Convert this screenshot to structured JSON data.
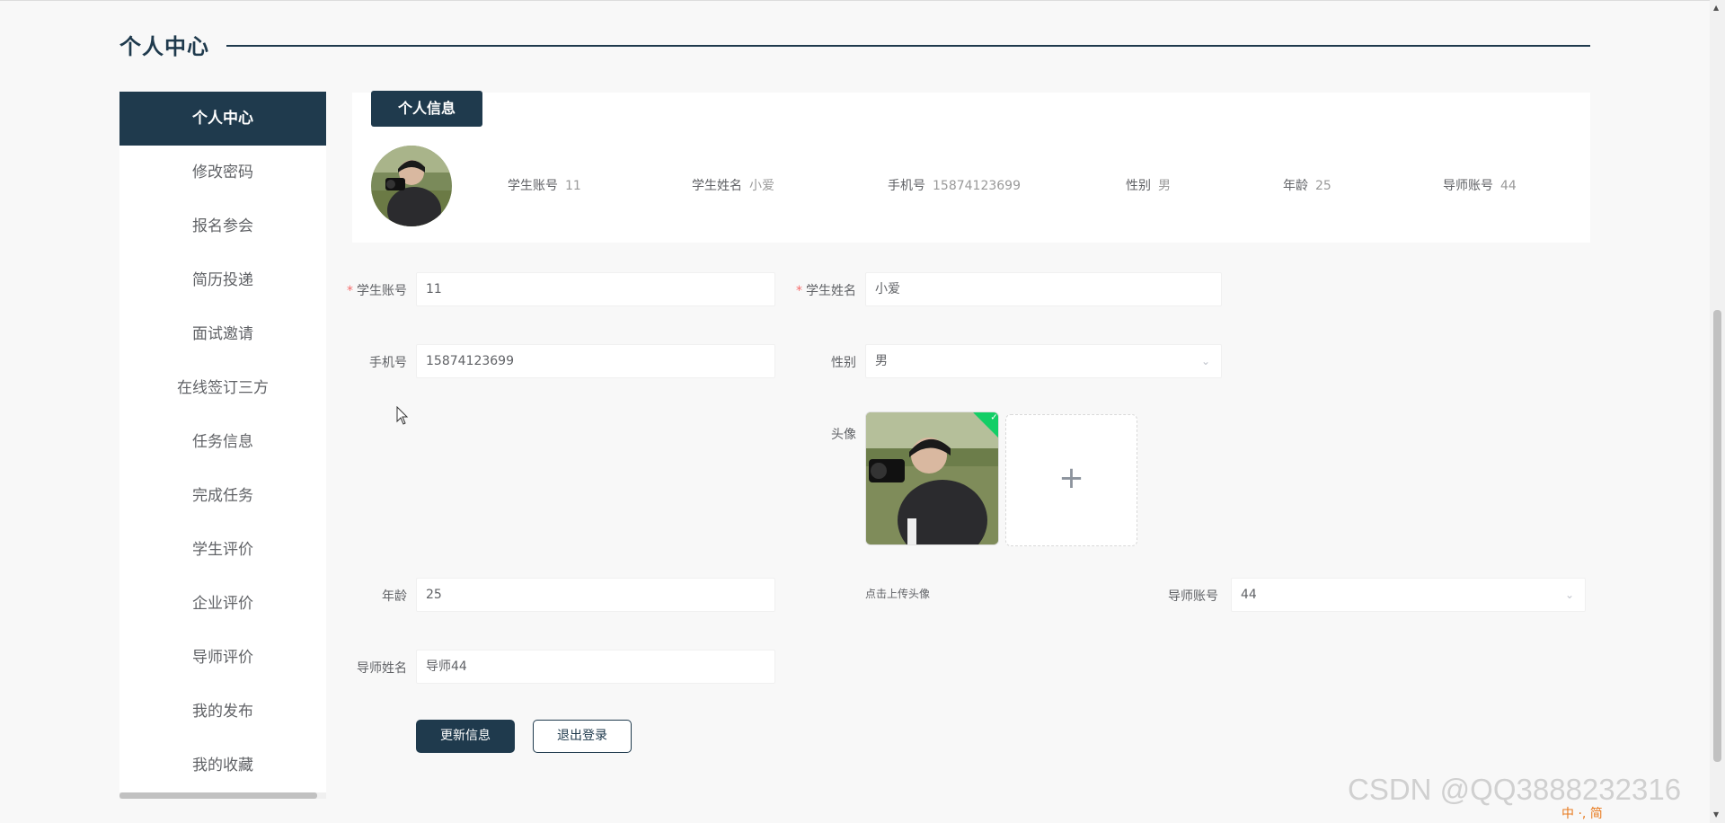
{
  "page": {
    "title": "个人中心"
  },
  "sidebar": {
    "items": [
      {
        "label": "个人中心"
      },
      {
        "label": "修改密码"
      },
      {
        "label": "报名参会"
      },
      {
        "label": "简历投递"
      },
      {
        "label": "面试邀请"
      },
      {
        "label": "在线签订三方"
      },
      {
        "label": "任务信息"
      },
      {
        "label": "完成任务"
      },
      {
        "label": "学生评价"
      },
      {
        "label": "企业评价"
      },
      {
        "label": "导师评价"
      },
      {
        "label": "我的发布"
      },
      {
        "label": "我的收藏"
      }
    ]
  },
  "info": {
    "tab": "个人信息",
    "fields": [
      {
        "label": "学生账号",
        "value": "11"
      },
      {
        "label": "学生姓名",
        "value": "小爱"
      },
      {
        "label": "手机号",
        "value": "15874123699"
      },
      {
        "label": "性别",
        "value": "男"
      },
      {
        "label": "年龄",
        "value": "25"
      },
      {
        "label": "导师账号",
        "value": "44"
      }
    ]
  },
  "form": {
    "student_account": {
      "label": "学生账号",
      "value": "11",
      "required": true
    },
    "student_name": {
      "label": "学生姓名",
      "value": "小爱",
      "required": true
    },
    "phone": {
      "label": "手机号",
      "value": "15874123699"
    },
    "gender": {
      "label": "性别",
      "value": "男"
    },
    "avatar": {
      "label": "头像",
      "tip": "点击上传头像",
      "add_icon": "+"
    },
    "age": {
      "label": "年龄",
      "value": "25"
    },
    "tutor_account": {
      "label": "导师账号",
      "value": "44"
    },
    "tutor_name": {
      "label": "导师姓名",
      "value": "导师44"
    },
    "required_mark": "*"
  },
  "buttons": {
    "update": "更新信息",
    "logout": "退出登录"
  },
  "watermark": "CSDN @QQ3888232316",
  "ime": "中 ·, 简",
  "colors": {
    "primary": "#1f3a4d",
    "required": "#f56c6c",
    "success": "#13ce66"
  }
}
